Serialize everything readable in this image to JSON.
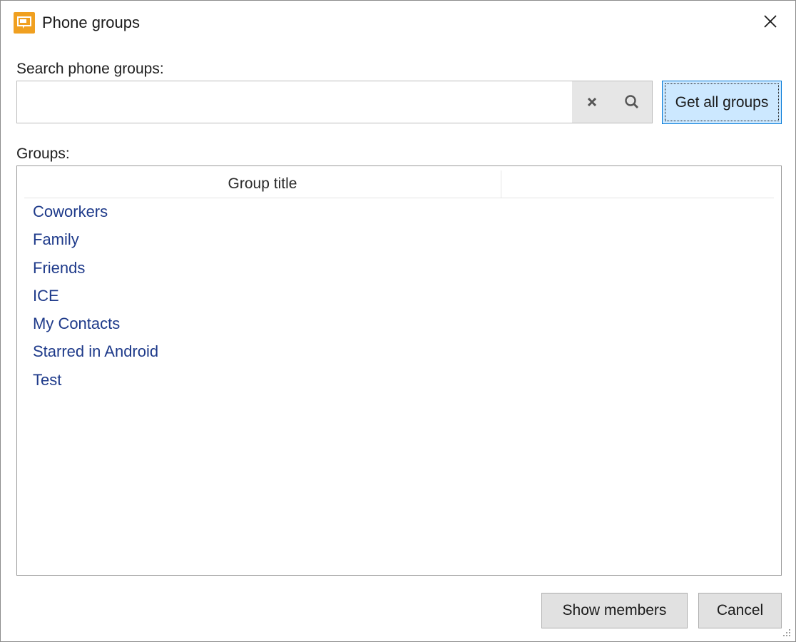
{
  "window": {
    "title": "Phone groups",
    "app_icon": "monitor-speech-icon",
    "close_icon": "close-icon"
  },
  "search": {
    "label": "Search phone groups:",
    "value": "",
    "placeholder": "",
    "clear_icon": "clear-icon",
    "search_icon": "search-icon",
    "get_all_label": "Get all groups"
  },
  "groups": {
    "label": "Groups:",
    "column_header": "Group title",
    "items": [
      "Coworkers",
      "Family",
      "Friends",
      "ICE",
      "My Contacts",
      "Starred in Android",
      "Test"
    ]
  },
  "footer": {
    "show_members_label": "Show members",
    "cancel_label": "Cancel"
  },
  "colors": {
    "accent": "#0078d7",
    "highlight_button": "#cce8ff",
    "app_icon_bg": "#f0a020",
    "list_text": "#1e3a8a"
  }
}
